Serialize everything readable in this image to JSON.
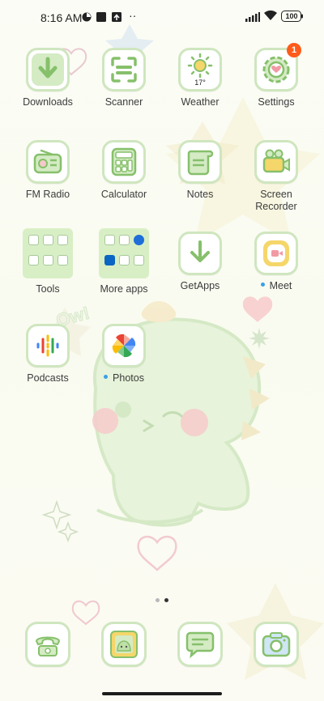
{
  "status_bar": {
    "time": "8:16 AM",
    "battery": "100",
    "more": "··"
  },
  "apps": [
    {
      "name": "Downloads",
      "icon": "downloads-icon"
    },
    {
      "name": "Scanner",
      "icon": "scanner-icon"
    },
    {
      "name": "Weather",
      "icon": "weather-icon",
      "temp": "17°"
    },
    {
      "name": "Settings",
      "icon": "settings-icon",
      "badge": "1"
    },
    {
      "name": "FM Radio",
      "icon": "radio-icon"
    },
    {
      "name": "Calculator",
      "icon": "calculator-icon"
    },
    {
      "name": "Notes",
      "icon": "notes-icon"
    },
    {
      "name": "Screen Recorder",
      "icon": "screen-recorder-icon"
    },
    {
      "name": "Tools",
      "icon": "folder-icon"
    },
    {
      "name": "More apps",
      "icon": "folder-icon"
    },
    {
      "name": "GetApps",
      "icon": "getapps-icon"
    },
    {
      "name": "Meet",
      "icon": "meet-icon"
    },
    {
      "name": "Podcasts",
      "icon": "podcasts-icon"
    },
    {
      "name": "Photos",
      "icon": "photos-icon"
    }
  ],
  "dock": [
    {
      "name": "Phone",
      "icon": "phone-icon"
    },
    {
      "name": "Gallery",
      "icon": "gallery-icon"
    },
    {
      "name": "Messages",
      "icon": "messages-icon"
    },
    {
      "name": "Camera",
      "icon": "camera-icon"
    }
  ],
  "colors": {
    "tile_border": "#cfe6bf",
    "icon_green": "#86c06b",
    "badge": "#ff5b1a",
    "notification_dot": "#3aa0e6"
  }
}
